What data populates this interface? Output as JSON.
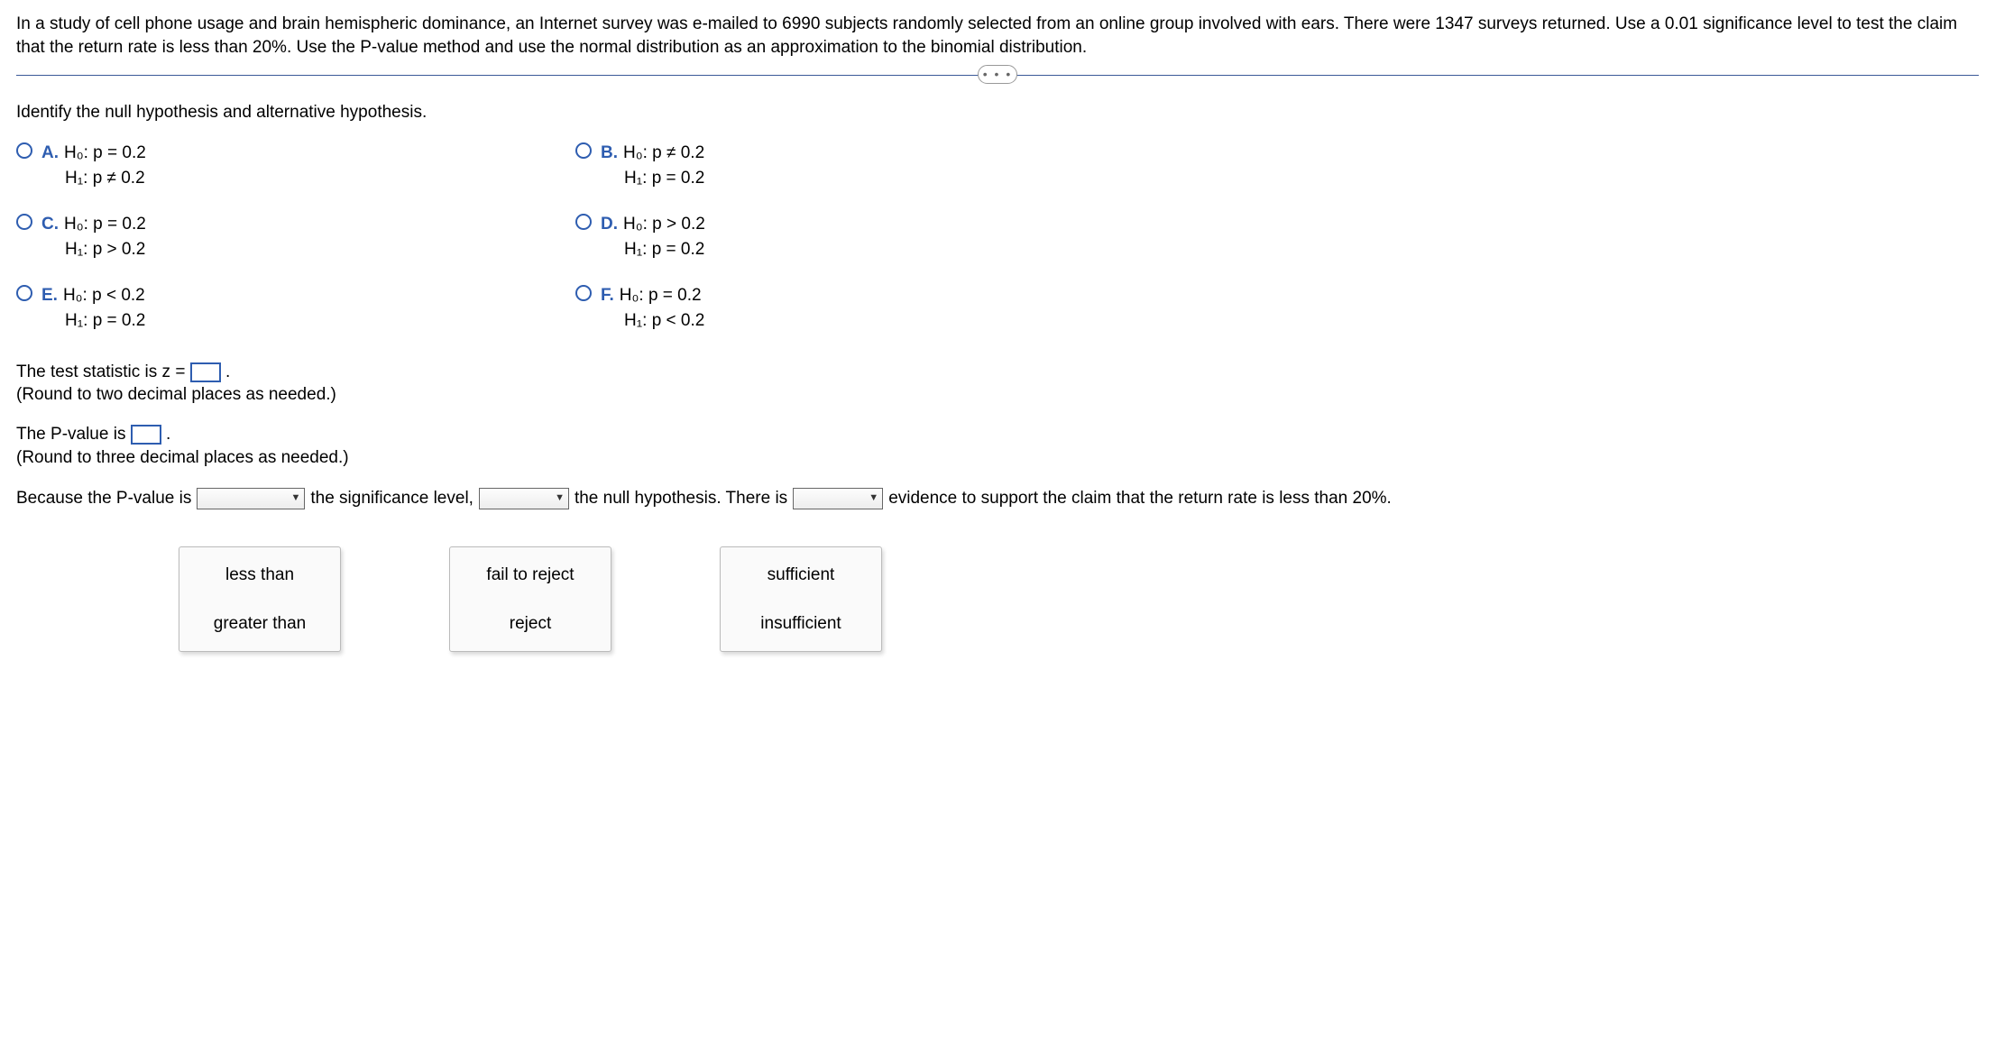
{
  "problem": "In a study of cell phone usage and brain hemispheric dominance, an Internet survey was e-mailed to 6990 subjects randomly selected from an online group involved with ears. There were 1347 surveys returned. Use a 0.01 significance level to test the claim that the return rate is less than 20%. Use the P-value method and use the normal distribution as an approximation to the binomial distribution.",
  "divider_glyph": "• • •",
  "q1": {
    "prompt": "Identify the null hypothesis and alternative hypothesis.",
    "options": {
      "A": {
        "l1": "H₀: p = 0.2",
        "l2": "H₁: p ≠ 0.2"
      },
      "B": {
        "l1": "H₀: p ≠ 0.2",
        "l2": "H₁: p = 0.2"
      },
      "C": {
        "l1": "H₀: p = 0.2",
        "l2": "H₁: p > 0.2"
      },
      "D": {
        "l1": "H₀: p > 0.2",
        "l2": "H₁: p = 0.2"
      },
      "E": {
        "l1": "H₀: p < 0.2",
        "l2": "H₁: p = 0.2"
      },
      "F": {
        "l1": "H₀: p = 0.2",
        "l2": "H₁: p < 0.2"
      }
    },
    "letters": {
      "A": "A.",
      "B": "B.",
      "C": "C.",
      "D": "D.",
      "E": "E.",
      "F": "F."
    }
  },
  "stmt_z_pre": "The test statistic is z = ",
  "stmt_z_post": ".",
  "stmt_z_hint": "(Round to two decimal places as needed.)",
  "stmt_p_pre": "The P-value is ",
  "stmt_p_post": ".",
  "stmt_p_hint": "(Round to three decimal places as needed.)",
  "conclusion": {
    "t1": "Because the P-value is",
    "t2": "the significance level,",
    "t3": "the null hypothesis. There is",
    "t4": "evidence to support the claim that the return rate is less than 20%."
  },
  "dropdown_choices": {
    "d1": {
      "a": "less than",
      "b": "greater than"
    },
    "d2": {
      "a": "fail to reject",
      "b": "reject"
    },
    "d3": {
      "a": "sufficient",
      "b": "insufficient"
    }
  }
}
